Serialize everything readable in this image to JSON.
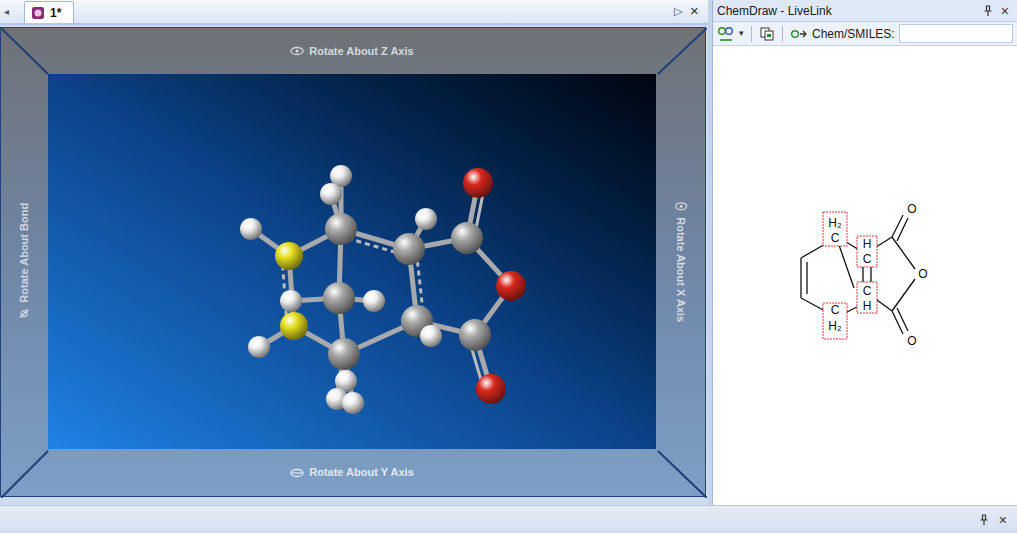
{
  "document_tabs": {
    "scroll_left": "◂",
    "tabs": [
      {
        "label": "1*",
        "selected": true
      }
    ],
    "scroll_right": "▷",
    "close": "×"
  },
  "viewer": {
    "labels": {
      "top": "Rotate About Z Axis",
      "bottom": "Rotate About Y Axis",
      "left": "Rotate About Bond",
      "right": "Rotate About X Axis"
    },
    "atoms": [
      {
        "kind": "C",
        "color": "#a9a9a9"
      },
      {
        "kind": "C",
        "color": "#a9a9a9"
      },
      {
        "kind": "C",
        "color": "#a9a9a9"
      },
      {
        "kind": "O",
        "color": "#d8281e"
      },
      {
        "kind": "O",
        "color": "#d8281e"
      },
      {
        "kind": "C",
        "color": "#a9a9a9"
      },
      {
        "kind": "O",
        "color": "#d8281e"
      },
      {
        "kind": "C",
        "color": "#a9a9a9"
      },
      {
        "kind": "C",
        "color": "#a9a9a9"
      },
      {
        "kind": "C",
        "color": "#a9a9a9"
      },
      {
        "kind": "S",
        "color": "#e6df1e"
      },
      {
        "kind": "S",
        "color": "#e6df1e"
      },
      {
        "kind": "H",
        "color": "#f0f0f0"
      },
      {
        "kind": "H",
        "color": "#f0f0f0"
      },
      {
        "kind": "H",
        "color": "#f0f0f0"
      },
      {
        "kind": "H",
        "color": "#f0f0f0"
      },
      {
        "kind": "H",
        "color": "#f0f0f0"
      },
      {
        "kind": "H",
        "color": "#f0f0f0"
      },
      {
        "kind": "H",
        "color": "#f0f0f0"
      },
      {
        "kind": "H",
        "color": "#f0f0f0"
      },
      {
        "kind": "H",
        "color": "#f0f0f0"
      },
      {
        "kind": "H",
        "color": "#f0f0f0"
      },
      {
        "kind": "H",
        "color": "#f0f0f0"
      }
    ]
  },
  "livelink": {
    "title": "ChemDraw - LiveLink",
    "close": "×",
    "toolbar": {
      "dropdown": "▾",
      "field_label": "Chem/SMILES:",
      "field_value": ""
    },
    "structure": {
      "labels": [
        {
          "lines": [
            "H₂",
            "C"
          ],
          "highlighted": true
        },
        {
          "lines": [
            "H",
            "C"
          ],
          "highlighted": true
        },
        {
          "lines": [
            "C",
            "H"
          ],
          "highlighted": true
        },
        {
          "lines": [
            "C",
            "H₂"
          ],
          "highlighted": true
        },
        {
          "lines": [
            "O"
          ],
          "highlighted": false
        },
        {
          "lines": [
            "O"
          ],
          "highlighted": false
        },
        {
          "lines": [
            "O"
          ],
          "highlighted": false
        }
      ]
    }
  },
  "bottom_panel": {
    "close": "×"
  }
}
